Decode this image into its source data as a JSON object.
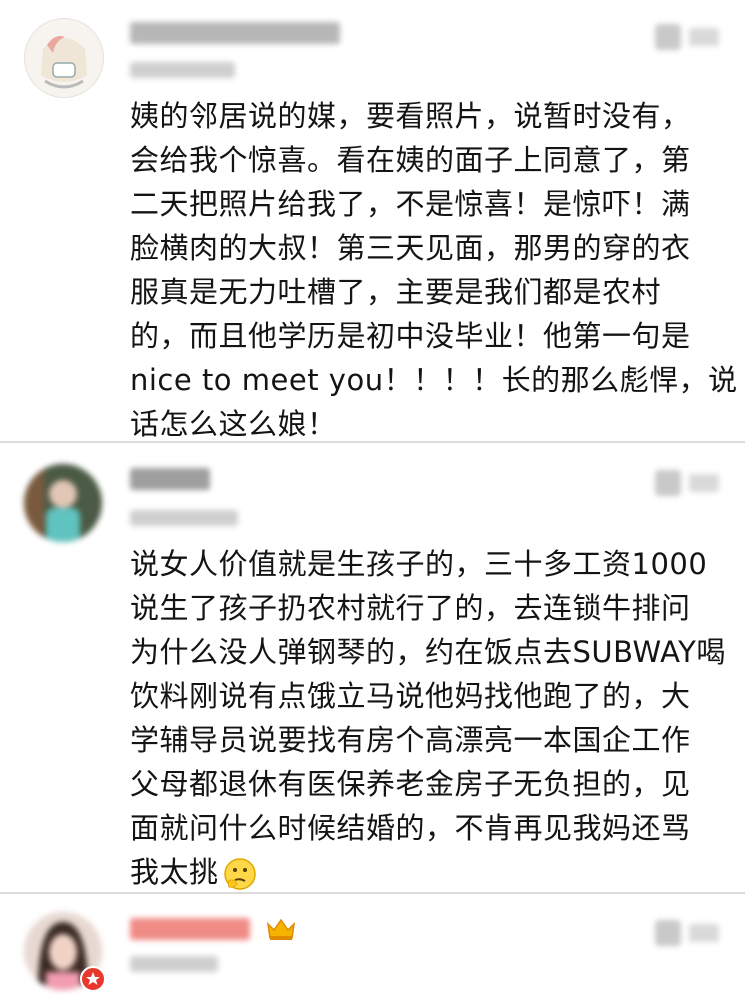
{
  "comments": [
    {
      "lines": [
        "姨的邻居说的媒，要看照片，说暂时没有，",
        "会给我个惊喜。看在姨的面子上同意了，第",
        "二天把照片给我了，不是惊喜！是惊吓！满",
        "脸横肉的大叔！第三天见面，那男的穿的衣",
        "服真是无力吐槽了，主要是我们都是农村",
        "的，而且他学历是初中没毕业！他第一句是",
        "nice to meet you！！！！长的那么彪悍，说",
        "话怎么这么娘！"
      ]
    },
    {
      "lines": [
        "说女人价值就是生孩子的，三十多工资1000",
        "说生了孩子扔农村就行了的，去连锁牛排问",
        "为什么没人弹钢琴的，约在饭点去SUBWAY喝",
        "饮料刚说有点饿立马说他妈找他跑了的，大",
        "学辅导员说要找有房个高漂亮一本国企工作",
        "父母都退休有医保养老金房子无负担的，见",
        "面就问什么时候结婚的，不肯再见我妈还骂",
        "我太挑"
      ],
      "emoji": "thinking-face"
    }
  ],
  "colors": {
    "text": "#141414",
    "vip_name": "#f06a6a",
    "crown": "#f2a100",
    "divider": "#dcdcdc"
  }
}
